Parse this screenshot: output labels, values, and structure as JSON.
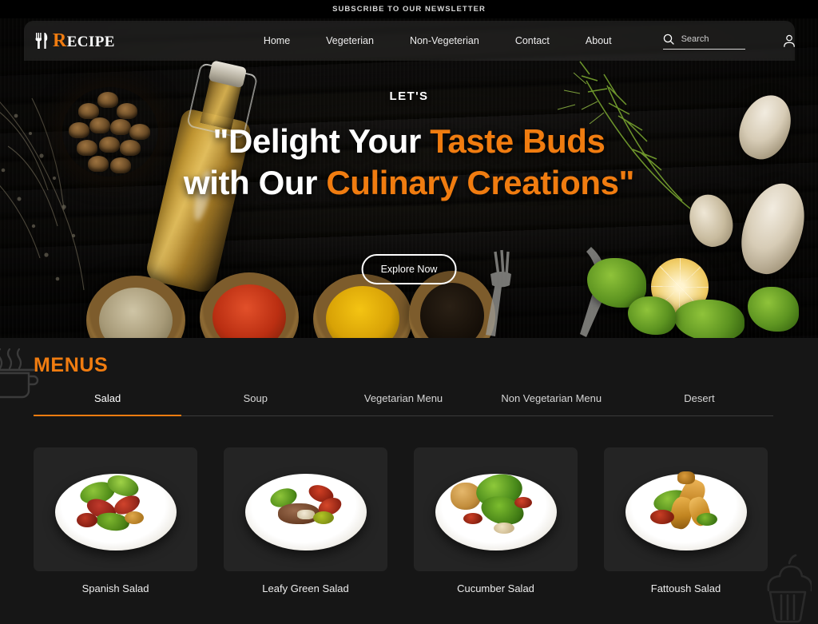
{
  "topbar": {
    "newsletter_text": "SUBSCRIBE TO OUR NEWSLETTER"
  },
  "header": {
    "logo_mark": "fork-knife-icon",
    "logo_initial": "R",
    "logo_rest": "ECIPE",
    "nav": [
      {
        "label": "Home"
      },
      {
        "label": "Vegeterian"
      },
      {
        "label": "Non-Vegeterian"
      },
      {
        "label": "Contact"
      },
      {
        "label": "About"
      }
    ],
    "search": {
      "placeholder": "Search",
      "value": "",
      "icon": "search-icon"
    },
    "icons": [
      {
        "name": "account-icon"
      },
      {
        "name": "wishlist-heart-icon"
      }
    ]
  },
  "hero": {
    "kicker": "LET'S",
    "title_line1_plain": "\"Delight Your ",
    "title_line1_highlight": "Taste Buds",
    "title_line2_plain": "with Our ",
    "title_line2_highlight": "Culinary Creations\"",
    "cta_label": "Explore Now",
    "accent_color": "#f07c10"
  },
  "menus": {
    "section_title": "MENUS",
    "decor_left_icon": "cooking-pot-icon",
    "decor_right_icon": "cupcake-icon",
    "active_tab_index": 0,
    "tabs": [
      {
        "label": "Salad"
      },
      {
        "label": "Soup"
      },
      {
        "label": "Vegetarian Menu"
      },
      {
        "label": "Non Vegetarian Menu"
      },
      {
        "label": "Desert"
      }
    ],
    "cards": [
      {
        "label": "Spanish Salad"
      },
      {
        "label": "Leafy Green Salad"
      },
      {
        "label": "Cucumber Salad"
      },
      {
        "label": "Fattoush Salad"
      }
    ]
  },
  "colors": {
    "accent": "#f07c10",
    "section_bg": "#161616",
    "card_bg": "#242424",
    "topbar_bg": "#000000"
  }
}
